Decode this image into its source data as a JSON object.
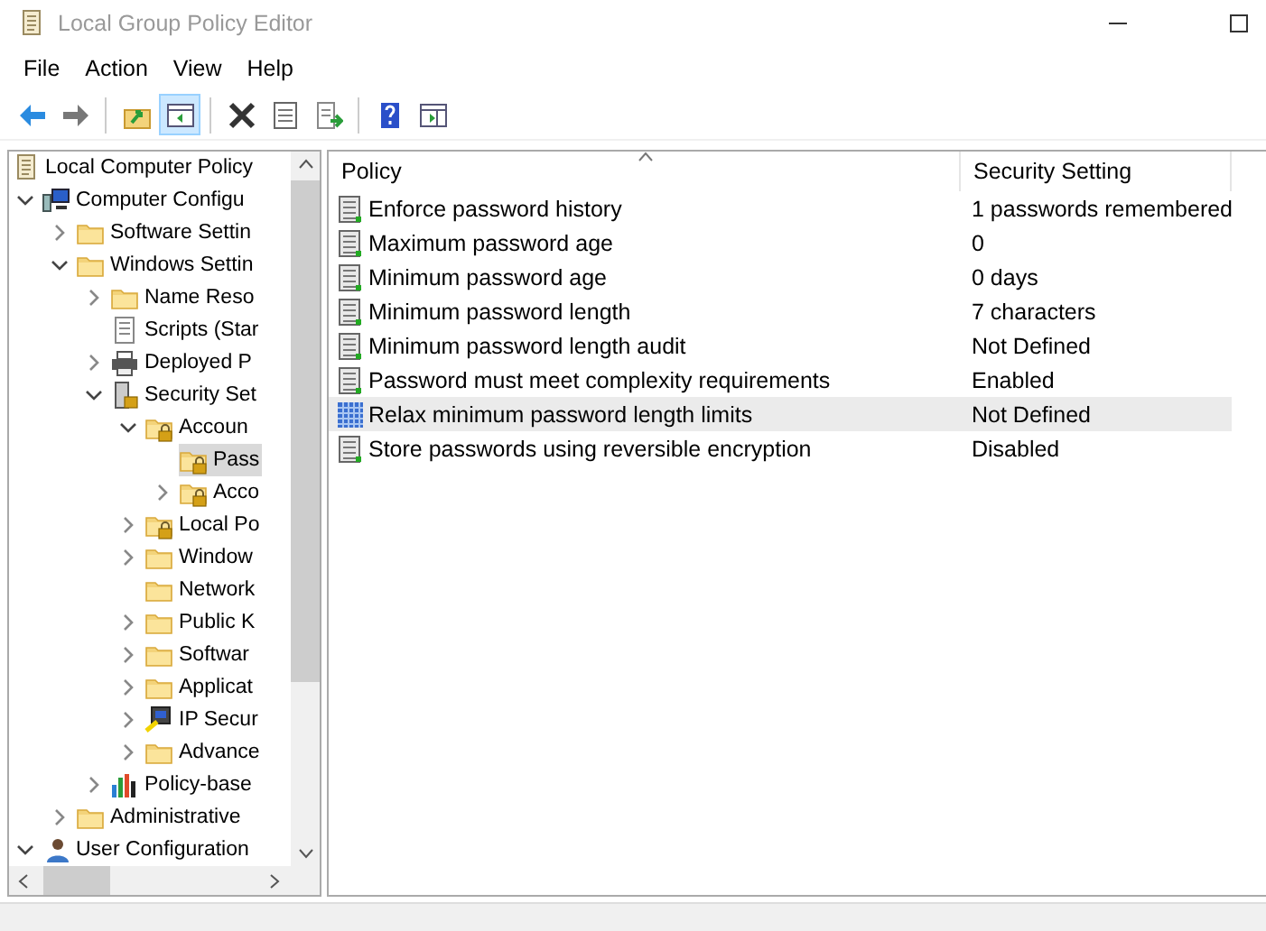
{
  "window": {
    "title": "Local Group Policy Editor"
  },
  "menu": [
    "File",
    "Action",
    "View",
    "Help"
  ],
  "toolbar": [
    [
      {
        "kind": "back",
        "selected": false
      },
      {
        "kind": "forward",
        "selected": false
      }
    ],
    [
      {
        "kind": "up",
        "selected": false
      },
      {
        "kind": "tree",
        "selected": true
      }
    ],
    [
      {
        "kind": "delete",
        "selected": false
      },
      {
        "kind": "properties",
        "selected": false
      },
      {
        "kind": "export",
        "selected": false
      }
    ],
    [
      {
        "kind": "help",
        "selected": false
      },
      {
        "kind": "action",
        "selected": false
      }
    ]
  ],
  "tree": [
    {
      "label": "Local Computer Policy",
      "kind": "policy",
      "selected": false,
      "children": [
        {
          "label": "Computer Configu",
          "kind": "computer",
          "expanded": true,
          "selected": false,
          "children": [
            {
              "label": "Software Settin",
              "kind": "folder",
              "expanded": false,
              "selected": false
            },
            {
              "label": "Windows Settin",
              "kind": "folder",
              "expanded": true,
              "selected": false,
              "children": [
                {
                  "label": "Name Reso",
                  "kind": "folder",
                  "expanded": false,
                  "selected": false
                },
                {
                  "label": "Scripts (Star",
                  "kind": "script",
                  "selected": false
                },
                {
                  "label": "Deployed P",
                  "kind": "printer",
                  "expanded": false,
                  "selected": false
                },
                {
                  "label": "Security Set",
                  "kind": "server",
                  "expanded": true,
                  "selected": false,
                  "children": [
                    {
                      "label": "Accoun",
                      "kind": "lockfolder",
                      "expanded": true,
                      "selected": false,
                      "children": [
                        {
                          "label": "Pass",
                          "kind": "lockfolder",
                          "selected": true
                        },
                        {
                          "label": "Acco",
                          "kind": "lockfolder",
                          "expanded": false,
                          "selected": false
                        }
                      ]
                    },
                    {
                      "label": "Local Po",
                      "kind": "lockfolder",
                      "expanded": false,
                      "selected": false
                    },
                    {
                      "label": "Window",
                      "kind": "folder",
                      "expanded": false,
                      "selected": false
                    },
                    {
                      "label": "Network",
                      "kind": "folder",
                      "selected": false
                    },
                    {
                      "label": "Public K",
                      "kind": "folder",
                      "expanded": false,
                      "selected": false
                    },
                    {
                      "label": "Softwar",
                      "kind": "folder",
                      "expanded": false,
                      "selected": false
                    },
                    {
                      "label": "Applicat",
                      "kind": "folder",
                      "expanded": false,
                      "selected": false
                    },
                    {
                      "label": "IP Secur",
                      "kind": "ipsec",
                      "expanded": false,
                      "selected": false
                    },
                    {
                      "label": "Advance",
                      "kind": "folder",
                      "expanded": false,
                      "selected": false
                    }
                  ]
                },
                {
                  "label": "Policy-base",
                  "kind": "chart",
                  "expanded": false,
                  "selected": false
                }
              ]
            },
            {
              "label": "Administrative",
              "kind": "folder",
              "expanded": false,
              "selected": false
            }
          ]
        },
        {
          "label": "User Configuration",
          "kind": "user",
          "expanded": true,
          "selected": false
        }
      ]
    }
  ],
  "table": {
    "columns": [
      "Policy",
      "Security Setting"
    ],
    "rows": [
      {
        "policy": "Enforce password history",
        "setting": "1 passwords remembered",
        "kind": "setting",
        "selected": false
      },
      {
        "policy": "Maximum password age",
        "setting": "0",
        "kind": "setting",
        "selected": false
      },
      {
        "policy": "Minimum password age",
        "setting": "0 days",
        "kind": "setting",
        "selected": false
      },
      {
        "policy": "Minimum password length",
        "setting": "7 characters",
        "kind": "setting",
        "selected": false
      },
      {
        "policy": "Minimum password length audit",
        "setting": "Not Defined",
        "kind": "setting",
        "selected": false
      },
      {
        "policy": "Password must meet complexity requirements",
        "setting": "Enabled",
        "kind": "setting",
        "selected": false
      },
      {
        "policy": "Relax minimum password length limits",
        "setting": "Not Defined",
        "kind": "pattern",
        "selected": true
      },
      {
        "policy": "Store passwords using reversible encryption",
        "setting": "Disabled",
        "kind": "setting",
        "selected": false
      }
    ]
  }
}
